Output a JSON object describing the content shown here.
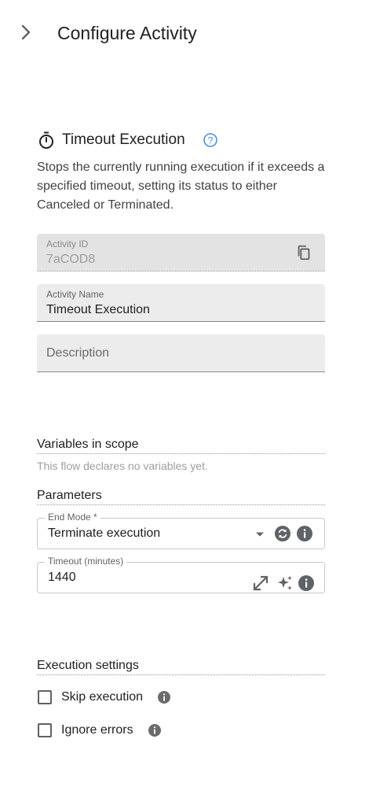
{
  "header": {
    "title": "Configure Activity",
    "collapse_icon": "chevron-right-icon"
  },
  "activity": {
    "title": "Timeout Execution",
    "icon": "timer-icon",
    "help_icon": "help-circle-icon",
    "description": "Stops the currently running execution if it exceeds a specified timeout, setting its status to either Canceled or Terminated."
  },
  "fields": {
    "activity_id": {
      "label": "Activity ID",
      "value": "7aCOD8"
    },
    "activity_name": {
      "label": "Activity Name",
      "value": "Timeout Execution"
    },
    "description": {
      "placeholder": "Description",
      "value": ""
    }
  },
  "variables": {
    "title": "Variables in scope",
    "empty_text": "This flow declares no variables yet."
  },
  "parameters": {
    "title": "Parameters",
    "end_mode": {
      "label": "End Mode *",
      "value": "Terminate execution"
    },
    "timeout": {
      "label": "Timeout (minutes)",
      "value": "1440"
    }
  },
  "execution_settings": {
    "title": "Execution settings",
    "skip_label": "Skip execution",
    "skip_checked": false,
    "ignore_label": "Ignore errors",
    "ignore_checked": false
  },
  "colors": {
    "accent": "#4a90e2",
    "icon_dark": "#5f6368",
    "field_bg": "#ececec"
  }
}
